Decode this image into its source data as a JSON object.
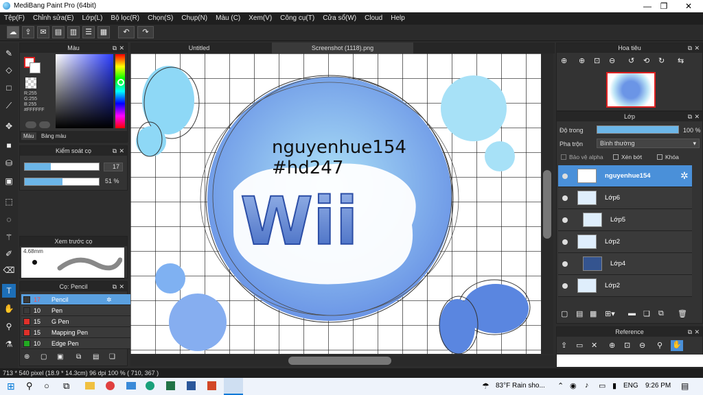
{
  "app": {
    "title": "MediBang Paint Pro (64bit)"
  },
  "menu": [
    "Tệp(F)",
    "Chỉnh sửa(E)",
    "Lớp(L)",
    "Bộ lọc(R)",
    "Chọn(S)",
    "Chụp(N)",
    "Màu (C)",
    "Xem(V)",
    "Công cụ(T)",
    "Cửa sổ(W)",
    "Cloud",
    "Help"
  ],
  "tabs": {
    "tab1": "Untitled",
    "tab2": "Screenshot (1118).png"
  },
  "color_panel": {
    "title": "Màu",
    "r": "R:255",
    "g": "G:255",
    "b": "B:255",
    "hex": "#FFFFFF",
    "tab1": "Màu",
    "tab2": "Bảng màu",
    "primary": "#ffffff",
    "secondary": "#ff0000"
  },
  "brush_control": {
    "title": "Kiểm soát cọ",
    "size": "17",
    "opacity": "51 %",
    "size_fill": 0.35,
    "opacity_fill": 0.51
  },
  "preview": {
    "title": "Xem trước cọ",
    "size_label": "4.68mm"
  },
  "brush_list": {
    "title": "Cọ: Pencil",
    "items": [
      {
        "size": "17",
        "name": "Pencil",
        "color": "#3a3a3a"
      },
      {
        "size": "10",
        "name": "Pen",
        "color": "#3a3a3a"
      },
      {
        "size": "15",
        "name": "G Pen",
        "color": "#e0302a"
      },
      {
        "size": "15",
        "name": "Mapping Pen",
        "color": "#e0302a"
      },
      {
        "size": "10",
        "name": "Edge Pen",
        "color": "#22aa22"
      }
    ]
  },
  "canvas_text": {
    "line1": "nguyenhue154",
    "line2": "#hd247"
  },
  "navigator": {
    "title": "Hoa tiêu"
  },
  "layer_panel": {
    "title": "Lớp",
    "opacity_label": "Độ trong",
    "opacity_value": "100 %",
    "blend_label": "Pha trộn",
    "blend_value": "Bình thường",
    "protect_alpha": "Bảo vệ alpha",
    "clipping": "Xén bớt",
    "lock": "Khóa",
    "layers": [
      "nguyenhue154",
      "Lớp6",
      "Lớp5",
      "Lớp2",
      "Lớp4",
      "Lớp2"
    ]
  },
  "reference": {
    "title": "Reference"
  },
  "status": {
    "text": "713 * 540 pixel   (18.9 * 14.3cm)   96 dpi   100 %   ( 710, 367 )"
  },
  "taskbar": {
    "weather": "83°F  Rain sho...",
    "lang": "ENG",
    "time": "9:26 PM"
  }
}
